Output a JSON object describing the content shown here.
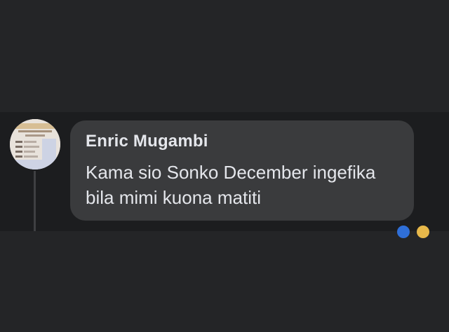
{
  "comment": {
    "author": "Enric Mugambi",
    "text": "Kama sio Sonko December ingefika bila mimi kuona matiti",
    "avatar_icon": "id-card-avatar",
    "reaction_icons": [
      "like-reaction-icon",
      "haha-reaction-icon"
    ]
  },
  "colors": {
    "background": "#242527",
    "comment_strip": "#1c1d1f",
    "bubble": "#3a3b3d",
    "text": "#e4e6eb",
    "like": "#2f6fd8",
    "haha": "#e7b84a"
  }
}
